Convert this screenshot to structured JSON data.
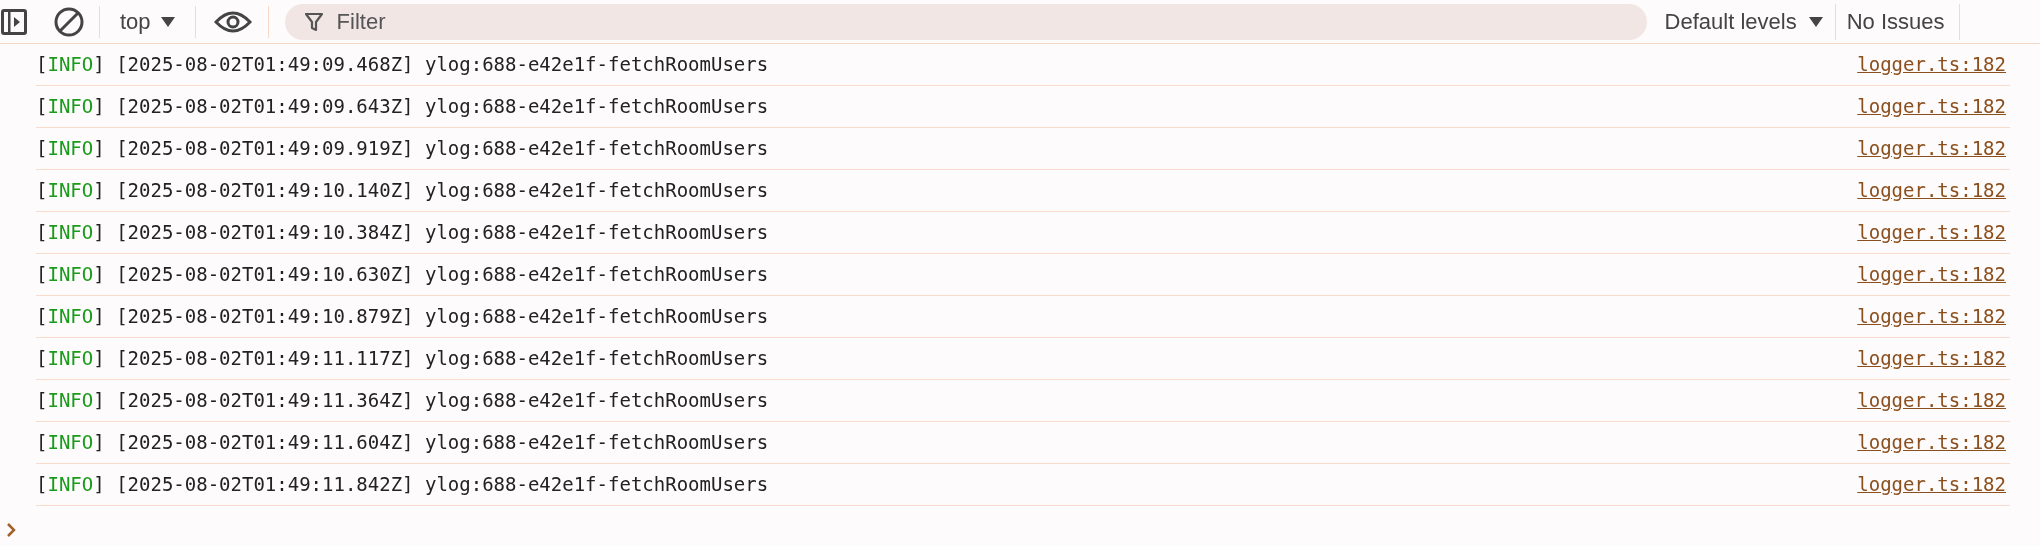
{
  "toolbar": {
    "context": "top",
    "filter": {
      "placeholder": "Filter"
    },
    "levels": "Default levels",
    "issues": "No Issues"
  },
  "messages": [
    {
      "level_open": "[",
      "level": "INFO",
      "level_close": "]",
      "text": "[2025-08-02T01:49:09.468Z] ylog:688-e42e1f-fetchRoomUsers",
      "source": "logger.ts:182"
    },
    {
      "level_open": "[",
      "level": "INFO",
      "level_close": "]",
      "text": "[2025-08-02T01:49:09.643Z] ylog:688-e42e1f-fetchRoomUsers",
      "source": "logger.ts:182"
    },
    {
      "level_open": "[",
      "level": "INFO",
      "level_close": "]",
      "text": "[2025-08-02T01:49:09.919Z] ylog:688-e42e1f-fetchRoomUsers",
      "source": "logger.ts:182"
    },
    {
      "level_open": "[",
      "level": "INFO",
      "level_close": "]",
      "text": "[2025-08-02T01:49:10.140Z] ylog:688-e42e1f-fetchRoomUsers",
      "source": "logger.ts:182"
    },
    {
      "level_open": "[",
      "level": "INFO",
      "level_close": "]",
      "text": "[2025-08-02T01:49:10.384Z] ylog:688-e42e1f-fetchRoomUsers",
      "source": "logger.ts:182"
    },
    {
      "level_open": "[",
      "level": "INFO",
      "level_close": "]",
      "text": "[2025-08-02T01:49:10.630Z] ylog:688-e42e1f-fetchRoomUsers",
      "source": "logger.ts:182"
    },
    {
      "level_open": "[",
      "level": "INFO",
      "level_close": "]",
      "text": "[2025-08-02T01:49:10.879Z] ylog:688-e42e1f-fetchRoomUsers",
      "source": "logger.ts:182"
    },
    {
      "level_open": "[",
      "level": "INFO",
      "level_close": "]",
      "text": "[2025-08-02T01:49:11.117Z] ylog:688-e42e1f-fetchRoomUsers",
      "source": "logger.ts:182"
    },
    {
      "level_open": "[",
      "level": "INFO",
      "level_close": "]",
      "text": "[2025-08-02T01:49:11.364Z] ylog:688-e42e1f-fetchRoomUsers",
      "source": "logger.ts:182"
    },
    {
      "level_open": "[",
      "level": "INFO",
      "level_close": "]",
      "text": "[2025-08-02T01:49:11.604Z] ylog:688-e42e1f-fetchRoomUsers",
      "source": "logger.ts:182"
    },
    {
      "level_open": "[",
      "level": "INFO",
      "level_close": "]",
      "text": "[2025-08-02T01:49:11.842Z] ylog:688-e42e1f-fetchRoomUsers",
      "source": "logger.ts:182"
    }
  ]
}
